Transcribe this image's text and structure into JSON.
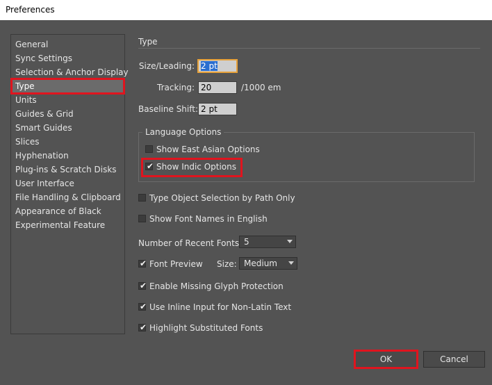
{
  "window": {
    "title": "Preferences"
  },
  "sidebar": {
    "items": [
      {
        "label": "General"
      },
      {
        "label": "Sync Settings"
      },
      {
        "label": "Selection & Anchor Display"
      },
      {
        "label": "Type",
        "selected": true
      },
      {
        "label": "Units"
      },
      {
        "label": "Guides & Grid"
      },
      {
        "label": "Smart Guides"
      },
      {
        "label": "Slices"
      },
      {
        "label": "Hyphenation"
      },
      {
        "label": "Plug-ins & Scratch Disks"
      },
      {
        "label": "User Interface"
      },
      {
        "label": "File Handling & Clipboard"
      },
      {
        "label": "Appearance of Black"
      },
      {
        "label": "Experimental Feature"
      }
    ]
  },
  "main": {
    "section_title": "Type",
    "size_leading": {
      "label": "Size/Leading:",
      "value": "2 pt"
    },
    "tracking": {
      "label": "Tracking:",
      "value": "20",
      "unit": "/1000 em"
    },
    "baseline_shift": {
      "label": "Baseline Shift:",
      "value": "2 pt"
    },
    "language_options": {
      "legend": "Language Options",
      "show_east_asian": {
        "label": "Show East Asian Options",
        "checked": false
      },
      "show_indic": {
        "label": "Show Indic Options",
        "checked": true
      }
    },
    "type_object_selection": {
      "label": "Type Object Selection by Path Only",
      "checked": false
    },
    "show_font_names_english": {
      "label": "Show Font Names in English",
      "checked": false
    },
    "recent_fonts": {
      "label": "Number of Recent Fonts:",
      "value": "5"
    },
    "font_preview": {
      "label": "Font Preview",
      "checked": true,
      "size_label": "Size:",
      "size_value": "Medium"
    },
    "missing_glyph": {
      "label": "Enable Missing Glyph Protection",
      "checked": true
    },
    "inline_input": {
      "label": "Use Inline Input for Non-Latin Text",
      "checked": true
    },
    "highlight_substituted": {
      "label": "Highlight Substituted Fonts",
      "checked": true
    }
  },
  "buttons": {
    "ok": "OK",
    "cancel": "Cancel"
  },
  "colors": {
    "background": "#535353",
    "highlight_red": "#e0141e",
    "focus_orange": "#e8a23a"
  }
}
